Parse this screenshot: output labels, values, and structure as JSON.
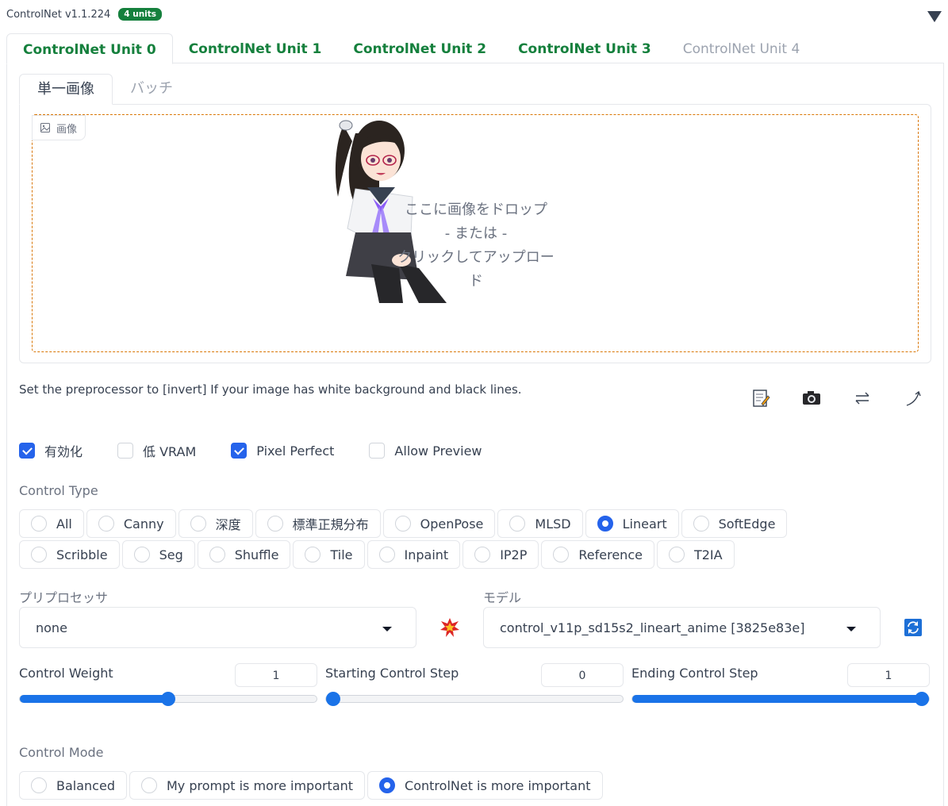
{
  "header": {
    "title": "ControlNet v1.1.224",
    "badge": "4 units"
  },
  "unit_tabs": [
    {
      "label": "ControlNet Unit 0",
      "active": true
    },
    {
      "label": "ControlNet Unit 1"
    },
    {
      "label": "ControlNet Unit 2"
    },
    {
      "label": "ControlNet Unit 3"
    },
    {
      "label": "ControlNet Unit 4",
      "disabled": true
    }
  ],
  "sub_tabs": [
    {
      "label": "単一画像",
      "active": true
    },
    {
      "label": "バッチ"
    }
  ],
  "image": {
    "label": "画像",
    "drop_line1": "ここに画像をドロップ",
    "drop_line2": "- または -",
    "drop_line3": "クリックしてアップロード"
  },
  "hint": "Set the preprocessor to [invert] If your image has white background and black lines.",
  "tools": [
    "edit-icon",
    "camera-icon",
    "swap-icon",
    "curve-arrow-icon"
  ],
  "checkboxes": [
    {
      "label": "有効化",
      "checked": true
    },
    {
      "label": "低 VRAM",
      "checked": false
    },
    {
      "label": "Pixel Perfect",
      "checked": true
    },
    {
      "label": "Allow Preview",
      "checked": false
    }
  ],
  "control_type": {
    "label": "Control Type",
    "options": [
      "All",
      "Canny",
      "深度",
      "標準正規分布",
      "OpenPose",
      "MLSD",
      "Lineart",
      "SoftEdge",
      "Scribble",
      "Seg",
      "Shuffle",
      "Tile",
      "Inpaint",
      "IP2P",
      "Reference",
      "T2IA"
    ],
    "selected": "Lineart"
  },
  "preprocessor": {
    "label": "プリプロセッサ",
    "value": "none"
  },
  "model": {
    "label": "モデル",
    "value": "control_v11p_sd15s2_lineart_anime [3825e83e]"
  },
  "sliders": [
    {
      "label": "Control Weight",
      "value": "1",
      "fraction": 0.5
    },
    {
      "label": "Starting Control Step",
      "value": "0",
      "fraction": 0.0
    },
    {
      "label": "Ending Control Step",
      "value": "1",
      "fraction": 1.0
    }
  ],
  "control_mode": {
    "label": "Control Mode",
    "options": [
      "Balanced",
      "My prompt is more important",
      "ControlNet is more important"
    ],
    "selected": "ControlNet is more important"
  },
  "colors": {
    "accent": "#2563eb",
    "tab_green": "#15803d",
    "slider": "#1a73e8",
    "drop_border": "#d97706"
  }
}
